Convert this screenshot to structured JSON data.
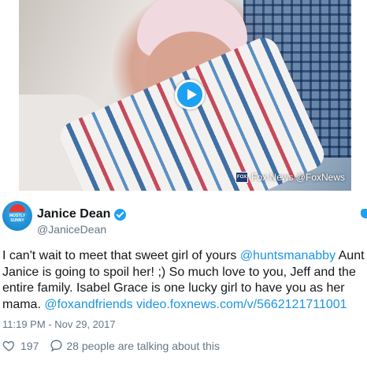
{
  "media": {
    "attribution": "Fox News @FoxNews",
    "logo_text": "FOX"
  },
  "author": {
    "display_name": "Janice Dean",
    "handle": "@JaniceDean",
    "avatar_text": "MOSTLY SUNNY"
  },
  "tweet": {
    "text_1": "I can't wait to meet that sweet girl of yours ",
    "mention_1": "@huntsmanabby",
    "text_2": " Aunt Janice is going to spoil her!  ;)  So much love to you, Jeff and the entire family. Isabel Grace is one lucky girl to have you as her mama. ",
    "mention_2": "@foxandfriends",
    "text_3": " ",
    "link": "video.foxnews.com/v/5662121711001"
  },
  "timestamp": "11:19 PM - Nov 29, 2017",
  "actions": {
    "likes": "197",
    "replies_text": "28 people are talking about this"
  },
  "colors": {
    "accent": "#1da1f2",
    "link": "#1b95e0",
    "muted": "#657786"
  }
}
